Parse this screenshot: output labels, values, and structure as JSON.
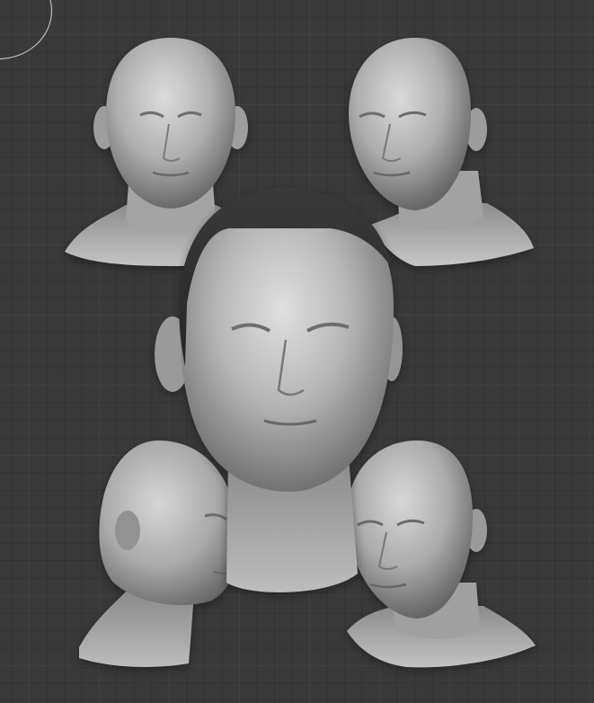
{
  "scene": {
    "background_color": "#3a3a3a",
    "grid_color": "#4a4a4a",
    "clay_colors": {
      "highlight": "#d8d8d8",
      "base": "#a9a9a9",
      "shadow": "#5e5e5e",
      "hair_cap": "#2c2c2c"
    },
    "models": [
      {
        "name": "bust-front",
        "view": "front"
      },
      {
        "name": "bust-three-quarter-right",
        "view": "three-quarter"
      },
      {
        "name": "bust-closeup-with-hair",
        "view": "front-closeup"
      },
      {
        "name": "bust-profile-right",
        "view": "profile"
      },
      {
        "name": "bust-three-quarter-lowered",
        "view": "three-quarter-down"
      }
    ]
  }
}
